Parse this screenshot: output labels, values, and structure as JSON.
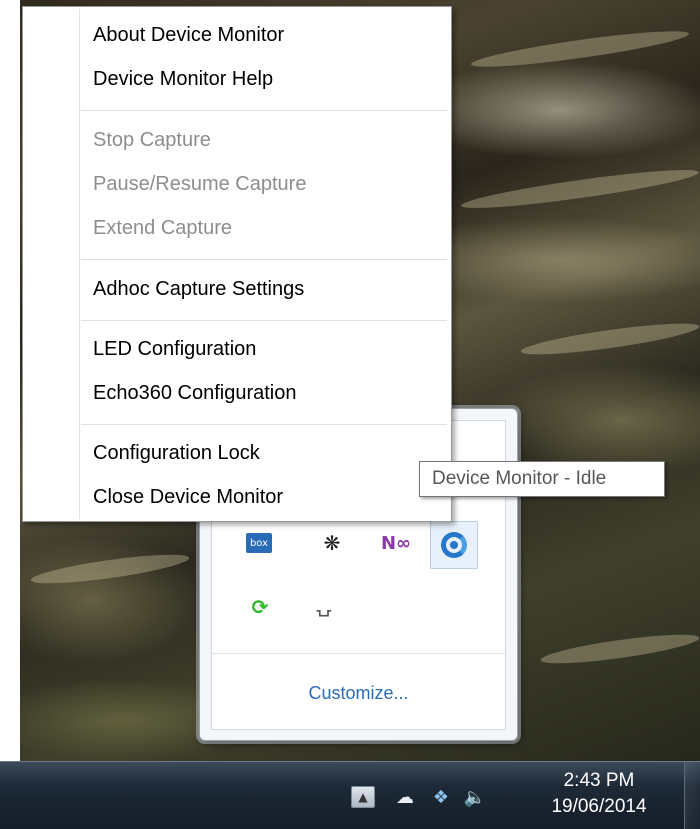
{
  "context_menu": {
    "items": [
      {
        "label": "About Device Monitor",
        "enabled": true
      },
      {
        "label": "Device Monitor Help",
        "enabled": true
      },
      {
        "label": "Stop Capture",
        "enabled": false
      },
      {
        "label": "Pause/Resume Capture",
        "enabled": false
      },
      {
        "label": "Extend Capture",
        "enabled": false
      },
      {
        "label": "Adhoc Capture Settings",
        "enabled": true
      },
      {
        "label": "LED Configuration",
        "enabled": true
      },
      {
        "label": "Echo360 Configuration",
        "enabled": true
      },
      {
        "label": "Configuration Lock",
        "enabled": true
      },
      {
        "label": "Close Device Monitor",
        "enabled": true
      }
    ]
  },
  "tooltip": {
    "text": "Device Monitor - Idle"
  },
  "tray_flyout": {
    "box_icon_label": "box",
    "customize_label": "Customize...",
    "icons": [
      "box-icon",
      "animal-icon",
      "onenote-icon",
      "echo360-icon",
      "sync-refresh-icon",
      "bell-icon"
    ]
  },
  "taskbar": {
    "time": "2:43 PM",
    "date": "19/06/2014",
    "tray_icons": [
      "show-hidden-icons-button",
      "cloud-icon",
      "dropbox-icon",
      "speaker-icon"
    ]
  },
  "colors": {
    "link": "#2a6bb8",
    "disabled_text": "#8d8d8d",
    "echo360_blue": "#2577c9",
    "taskbar": "#1e2a38"
  }
}
